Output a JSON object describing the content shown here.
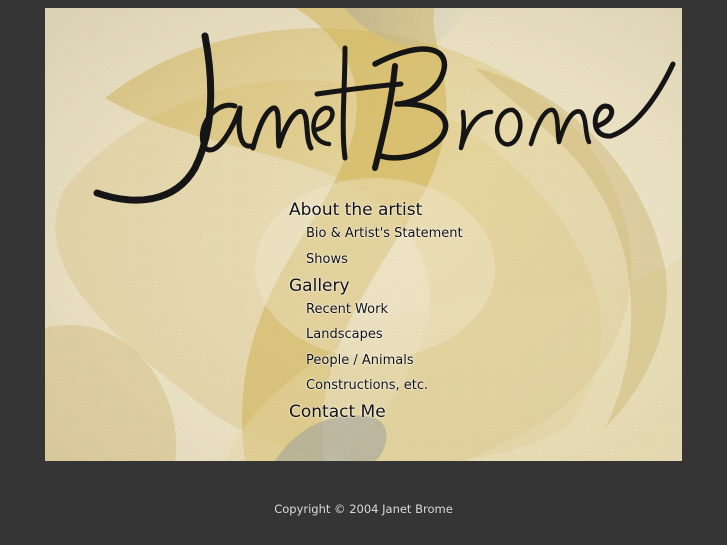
{
  "signature_text": "Janet Brome",
  "menu": {
    "about": {
      "label": "About the artist",
      "items": [
        "Bio & Artist's Statement",
        "Shows"
      ]
    },
    "gallery": {
      "label": "Gallery",
      "items": [
        "Recent Work",
        "Landscapes",
        "People / Animals",
        "Constructions, etc."
      ]
    },
    "contact": {
      "label": "Contact Me"
    }
  },
  "footer": {
    "copyright": "Copyright © 2004 Janet Brome"
  },
  "colors": {
    "background": "#353535",
    "artwork_gold": "#d9b54a",
    "text": "#111111",
    "footer_text": "#d9d9d9"
  }
}
